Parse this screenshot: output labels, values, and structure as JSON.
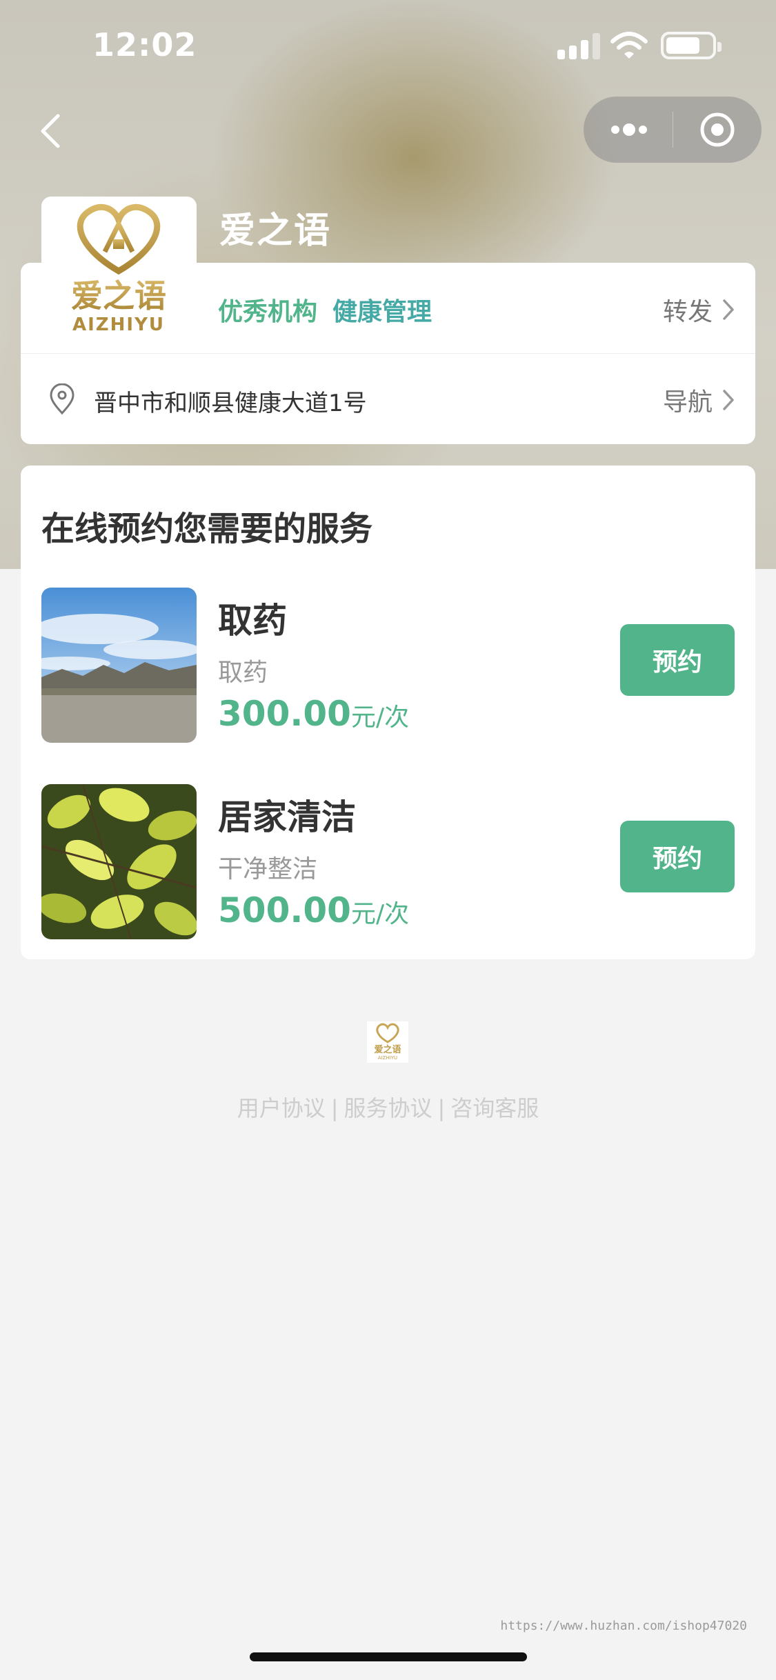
{
  "status_bar": {
    "time": "12:02"
  },
  "store": {
    "name": "爱之语",
    "logo": {
      "chinese": "爱之语",
      "latin": "AIZHIYU"
    },
    "tags": [
      "优秀机构",
      "健康管理"
    ],
    "share_label": "转发",
    "address": "晋中市和顺县健康大道1号",
    "navigate_label": "导航"
  },
  "services_section": {
    "title": "在线预约您需要的服务",
    "items": [
      {
        "name": "取药",
        "desc": "取药",
        "price": "300.00",
        "unit": "元/次",
        "button": "预约",
        "image": "mountain-sky-photo"
      },
      {
        "name": "居家清洁",
        "desc": "干净整洁",
        "price": "500.00",
        "unit": "元/次",
        "button": "预约",
        "image": "green-leaves-photo"
      }
    ]
  },
  "footer": {
    "links": [
      "用户协议",
      "服务协议",
      "咨询客服"
    ],
    "separator": "|"
  },
  "watermark": "https://www.huzhan.com/ishop47020",
  "colors": {
    "accent": "#52b48a",
    "accent_secondary": "#45a9a5",
    "background": "#f3f3f3"
  }
}
